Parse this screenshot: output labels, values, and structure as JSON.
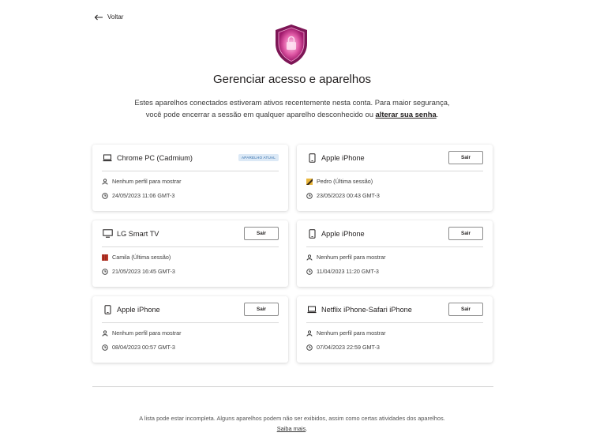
{
  "nav": {
    "back_label": "Voltar"
  },
  "header": {
    "title": "Gerenciar acesso e aparelhos",
    "intro_text": "Estes aparelhos conectados estiveram ativos recentemente nesta conta. Para maior segurança, você pode encerrar a sessão em qualquer aparelho desconhecido ou ",
    "intro_link": "alterar sua senha",
    "intro_end": "."
  },
  "devices": [
    {
      "name": "Chrome PC (Cadmium)",
      "device_icon": "laptop-icon",
      "badge": "Aparelho atual",
      "profile": "Nenhum perfil para mostrar",
      "profile_icon": "person-icon",
      "time": "24/05/2023 11:06 GMT-3"
    },
    {
      "name": "Apple iPhone",
      "device_icon": "phone-icon",
      "button": "Sair",
      "profile": "Pedro (Última sessão)",
      "profile_icon": "profile-avatar-icon",
      "profile_color": "#e8b53a",
      "time": "23/05/2023 00:43 GMT-3"
    },
    {
      "name": "LG Smart TV",
      "device_icon": "tv-icon",
      "button": "Sair",
      "profile": "Camila (Última sessão)",
      "profile_icon": "profile-avatar-icon",
      "profile_color": "#c0392b",
      "time": "21/05/2023 16:45 GMT-3"
    },
    {
      "name": "Apple iPhone",
      "device_icon": "phone-icon",
      "button": "Sair",
      "profile": "Nenhum perfil para mostrar",
      "profile_icon": "person-icon",
      "time": "11/04/2023 11:20 GMT-3"
    },
    {
      "name": "Apple iPhone",
      "device_icon": "phone-icon",
      "button": "Sair",
      "profile": "Nenhum perfil para mostrar",
      "profile_icon": "person-icon",
      "time": "08/04/2023 00:57 GMT-3"
    },
    {
      "name": "Netflix iPhone-Safari iPhone",
      "device_icon": "laptop-icon",
      "button": "Sair",
      "profile": "Nenhum perfil para mostrar",
      "profile_icon": "person-icon",
      "time": "07/04/2023 22:59 GMT-3"
    }
  ],
  "footer": {
    "text": "A lista pode estar incompleta. Alguns aparelhos podem não ser exibidos, assim como certas atividades dos aparelhos. ",
    "link": "Saiba mais",
    "end": "."
  },
  "icons": {
    "shield": "shield-lock-icon",
    "back": "arrow-left-icon",
    "clock": "clock-icon"
  },
  "colors": {
    "shield_primary": "#c0267f",
    "shield_accent": "#e85aa8",
    "badge_bg": "#dce9f6"
  }
}
